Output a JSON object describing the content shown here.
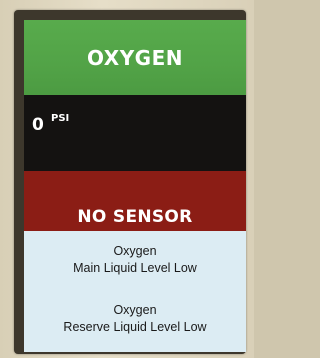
{
  "header": {
    "title": "OXYGEN",
    "color": "#55a74a"
  },
  "pressure": {
    "value": "0",
    "unit": "PSI"
  },
  "alarm": {
    "status": "NO SENSOR",
    "color": "#8b1d15"
  },
  "messages": [
    {
      "line1": "Oxygen",
      "line2": "Main Liquid Level Low"
    },
    {
      "line1": "Oxygen",
      "line2": "Reserve Liquid Level Low"
    }
  ]
}
